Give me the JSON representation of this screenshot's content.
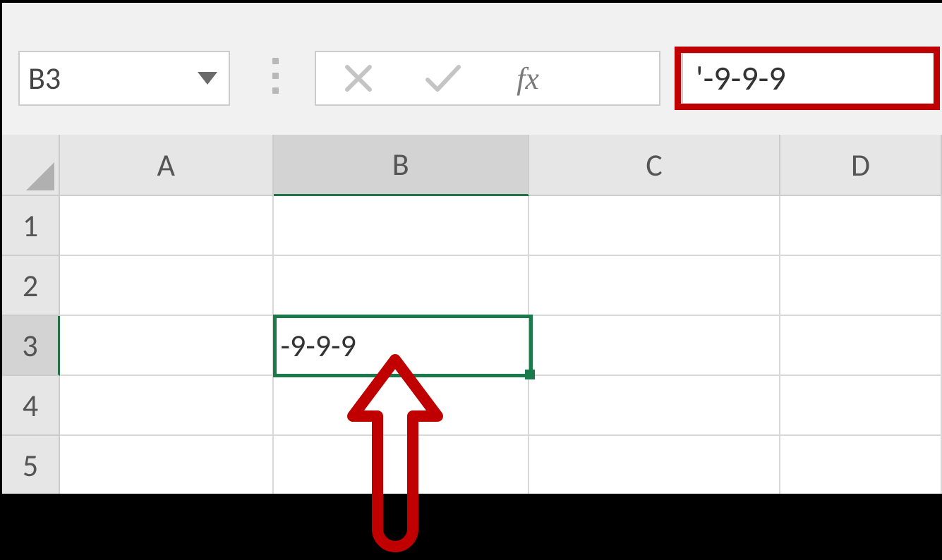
{
  "ribbon": {
    "name_box": "B3",
    "formula_bar": "'-9-9-9",
    "fx_label": "fx"
  },
  "columns": [
    "A",
    "B",
    "C",
    "D"
  ],
  "rows": [
    "1",
    "2",
    "3",
    "4",
    "5"
  ],
  "selected_col_index": 1,
  "selected_row_index": 2,
  "cells": {
    "B3": "-9-9-9"
  },
  "annotation": {
    "highlight_color": "#c00000",
    "selection_color": "#1a7a4a"
  }
}
